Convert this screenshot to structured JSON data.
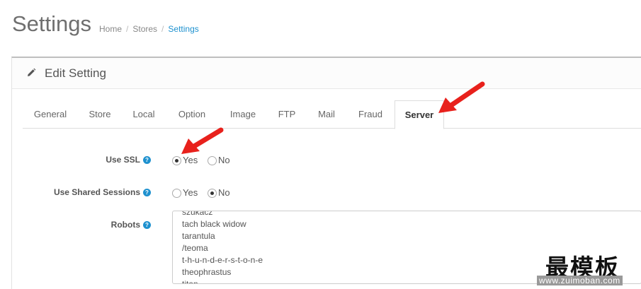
{
  "header": {
    "title": "Settings",
    "breadcrumb": [
      "Home",
      "Stores",
      "Settings"
    ]
  },
  "panel": {
    "title": "Edit Setting",
    "icon": "pencil-icon"
  },
  "tabs": [
    "General",
    "Store",
    "Local",
    "Option",
    "Image",
    "FTP",
    "Mail",
    "Fraud",
    "Server"
  ],
  "active_tab": "Server",
  "form": {
    "use_ssl": {
      "label": "Use SSL",
      "options": [
        "Yes",
        "No"
      ],
      "selected": "Yes"
    },
    "shared_sessions": {
      "label": "Use Shared Sessions",
      "options": [
        "Yes",
        "No"
      ],
      "selected": "No"
    },
    "robots": {
      "label": "Robots",
      "lines": [
        "szukacz",
        "tach black widow",
        "tarantula",
        "/teoma",
        "t-h-u-n-d-e-r-s-t-o-n-e",
        "theophrastus",
        "titan"
      ]
    }
  },
  "watermark": {
    "text": "最模板",
    "url": "www.zuimoban.com"
  },
  "colors": {
    "accent": "#1e91cf",
    "arrow": "#e8211c"
  }
}
